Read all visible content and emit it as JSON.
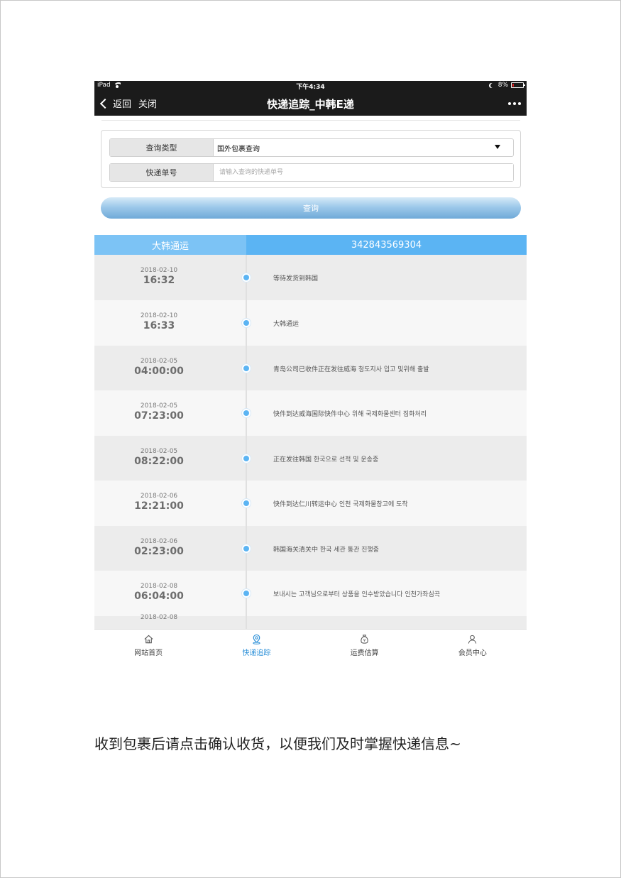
{
  "status_bar": {
    "device": "iPad",
    "time": "下午4:34",
    "battery": "8%"
  },
  "nav": {
    "back_label": "返回",
    "close_label": "关闭",
    "title": "快递追踪_中韩E递"
  },
  "form": {
    "query_type_label": "查询类型",
    "query_type_value": "国外包裹查询",
    "tracking_label": "快递单号",
    "tracking_placeholder": "请输入查询的快递单号",
    "submit_label": "查询"
  },
  "result": {
    "carrier": "大韩通运",
    "tracking_number": "342843569304",
    "events": [
      {
        "date": "2018-02-10",
        "time": "16:32",
        "desc": "等待发货到韩国"
      },
      {
        "date": "2018-02-10",
        "time": "16:33",
        "desc": "大韩通运"
      },
      {
        "date": "2018-02-05",
        "time": "04:00:00",
        "desc": "青岛公司已收件正在发往威海 청도지사 입고 및위해 출발"
      },
      {
        "date": "2018-02-05",
        "time": "07:23:00",
        "desc": "快件到达威海国际快件中心 위해 국제화물센터 집화처리"
      },
      {
        "date": "2018-02-05",
        "time": "08:22:00",
        "desc": "正在发往韩国 한국으로 선적 및 운송중"
      },
      {
        "date": "2018-02-06",
        "time": "12:21:00",
        "desc": "快件到达仁川转运中心 인천 국제화물창고에 도착"
      },
      {
        "date": "2018-02-06",
        "time": "02:23:00",
        "desc": "韩国海关清关中 한국 세관 통관 진행중"
      },
      {
        "date": "2018-02-08",
        "time": "06:04:00",
        "desc": "보내시는 고객님으로부터 상품을 인수받았습니다 인천가좌심곡"
      },
      {
        "date": "2018-02-08",
        "time": "",
        "desc": ""
      }
    ]
  },
  "tabs": [
    {
      "label": "网站首页",
      "icon": "home-icon",
      "active": false
    },
    {
      "label": "快递追踪",
      "icon": "location-pin-icon",
      "active": true
    },
    {
      "label": "运费估算",
      "icon": "money-bag-icon",
      "active": false
    },
    {
      "label": "会员中心",
      "icon": "user-icon",
      "active": false
    }
  ],
  "colors": {
    "accent": "#5bb4f3",
    "carrier_bg": "#7cc3f5",
    "active_tab": "#2a8fd8",
    "nav_bg": "#1b1b1b"
  },
  "footer_note": "收到包裹后请点击确认收货，以便我们及时掌握快递信息~"
}
